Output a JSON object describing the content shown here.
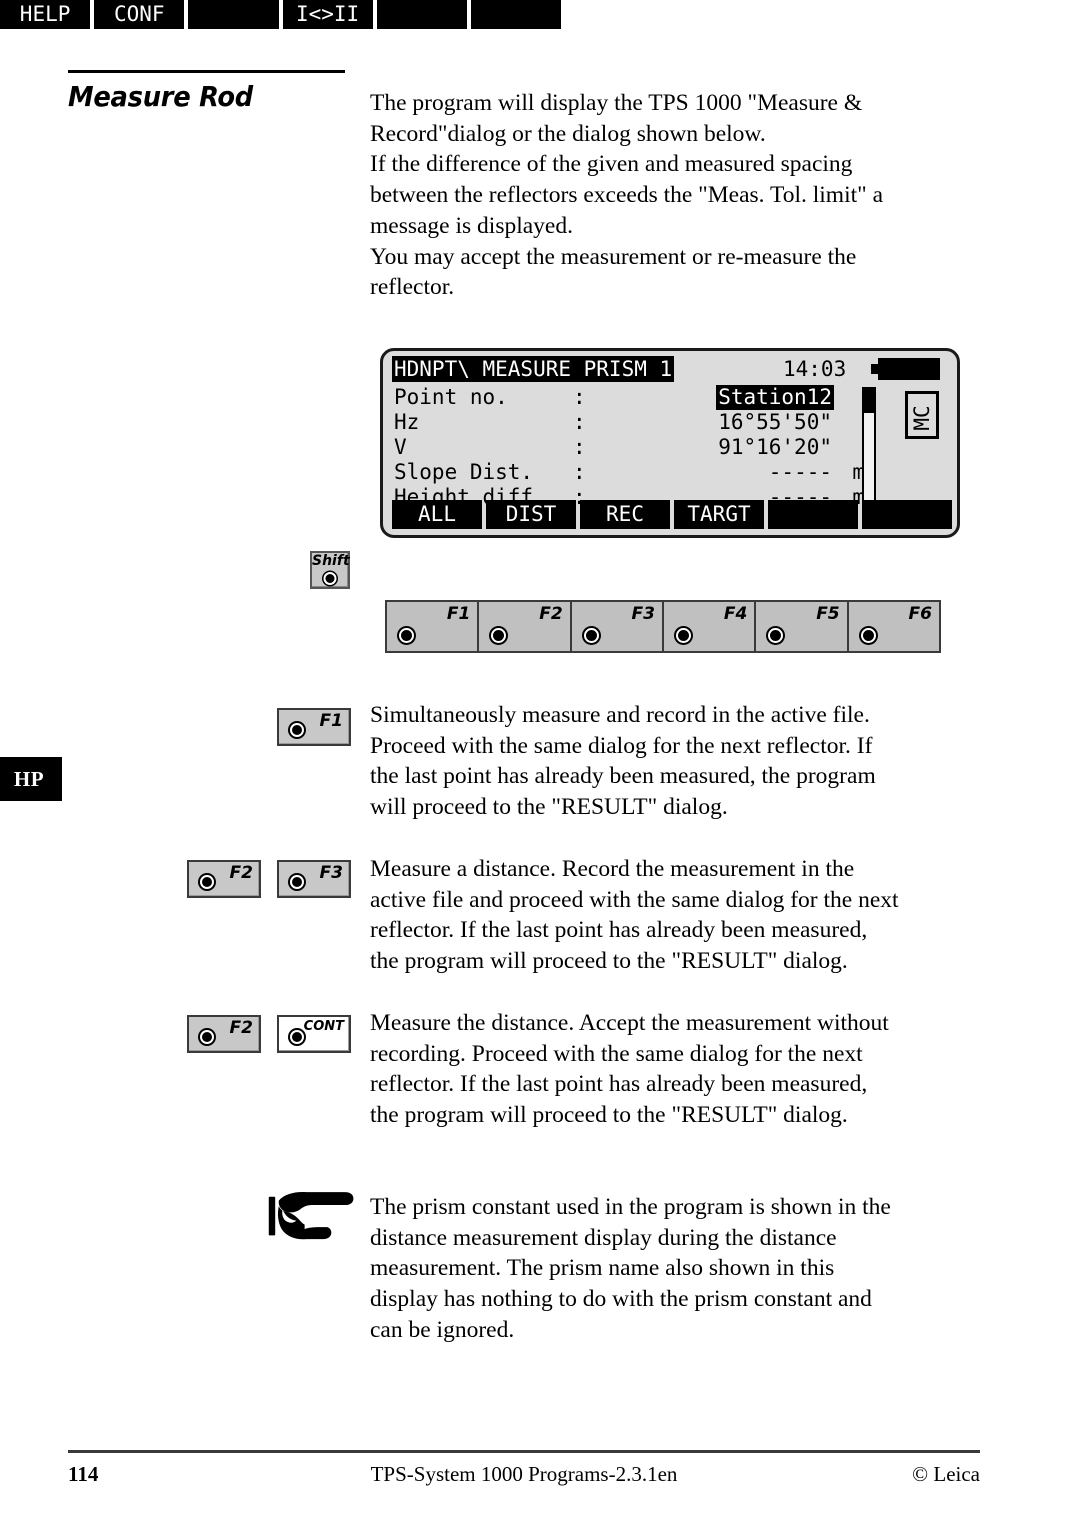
{
  "page": {
    "section_title": "Measure Rod",
    "margin_tab": "HP"
  },
  "intro": {
    "lines": [
      "The program will display the TPS 1000 \"Measure &",
      "Record\"dialog or the dialog shown below.",
      "If the difference of the given and measured spacing",
      "between the reflectors exceeds the \"Meas. Tol. limit\" a",
      "message is displayed.",
      "You may accept the measurement or re-measure the",
      "reflector."
    ]
  },
  "lcd": {
    "title": "HDNPT\\ MEASURE PRISM 1",
    "time": "14:03",
    "rows": [
      {
        "label": "Point no.",
        "colon": ":",
        "value": "Station12",
        "unit": "",
        "highlight": true
      },
      {
        "label": "Hz",
        "colon": ":",
        "value": "16°55'50\"",
        "unit": "",
        "highlight": false
      },
      {
        "label": "V",
        "colon": ":",
        "value": "91°16'20\"",
        "unit": "",
        "highlight": false
      },
      {
        "label": "Slope Dist.",
        "colon": ":",
        "value": "-----",
        "unit": "m",
        "highlight": false
      },
      {
        "label": "Height diff",
        "colon": ":",
        "value": "-----",
        "unit": "m",
        "highlight": false
      }
    ],
    "mc_indicator": "MC",
    "softkeys_row1": [
      "ALL",
      "DIST",
      "REC",
      "TARGT",
      "",
      ""
    ],
    "softkeys_row2": [
      "HELP",
      "CONF",
      "",
      "I<>II",
      "",
      ""
    ]
  },
  "keypad": {
    "shift_label": "Shift",
    "function_keys": [
      "F1",
      "F2",
      "F3",
      "F4",
      "F5",
      "F6"
    ]
  },
  "instructions": [
    {
      "keys": [
        "F1"
      ],
      "lines": [
        "Simultaneously measure and record in the active file.",
        "Proceed with the same dialog for the next reflector. If",
        "the last point has already been measured, the program",
        "will proceed  to the \"RESULT\" dialog."
      ]
    },
    {
      "keys": [
        "F2",
        "F3"
      ],
      "lines": [
        "Measure a distance. Record the measurement in the",
        "active file and proceed with the same dialog for the next",
        "reflector. If the last point has already been measured,",
        "the program will proceed  to the \"RESULT\" dialog."
      ]
    },
    {
      "keys": [
        "F2",
        "CONT"
      ],
      "lines": [
        "Measure the distance. Accept the measurement without",
        "recording. Proceed with the same dialog for the next",
        "reflector. If the last point has already been measured,",
        "the program will proceed  to the \"RESULT\" dialog."
      ]
    }
  ],
  "note": {
    "icon": "pointing-hand-icon",
    "lines": [
      "The prism constant used in the program is shown in the",
      "distance measurement display during the distance",
      "measurement. The prism name also shown in this",
      "display has nothing to do with the prism constant and",
      "can be ignored."
    ]
  },
  "footer": {
    "page_number": "114",
    "center": "TPS-System 1000 Programs-2.3.1en",
    "right": "© Leica"
  }
}
